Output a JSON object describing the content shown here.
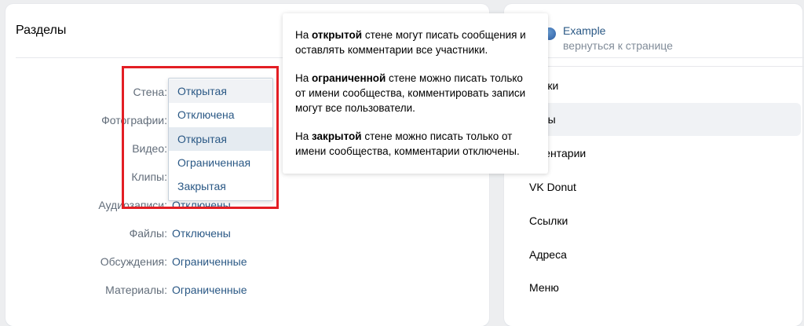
{
  "section_title": "Разделы",
  "rows": [
    {
      "label": "Стена:",
      "value": ""
    },
    {
      "label": "Фотографии:",
      "value": ""
    },
    {
      "label": "Видео:",
      "value": ""
    },
    {
      "label": "Клипы:",
      "value": ""
    },
    {
      "label": "Аудиозаписи:",
      "value": "Отключены"
    },
    {
      "label": "Файлы:",
      "value": "Отключены"
    },
    {
      "label": "Обсуждения:",
      "value": "Ограниченные"
    },
    {
      "label": "Материалы:",
      "value": "Ограниченные"
    }
  ],
  "dropdown": {
    "current": "Открытая",
    "options": [
      "Отключена",
      "Открытая",
      "Ограниченная",
      "Закрытая"
    ]
  },
  "tooltip": {
    "p1_a": "На ",
    "p1_b": "открытой",
    "p1_c": " стене могут писать сообщения и оставлять комментарии все участники.",
    "p2_a": "На ",
    "p2_b": "ограниченной",
    "p2_c": " стене можно писать только от имени сообщества, комментировать записи могут все пользователи.",
    "p3_a": "На ",
    "p3_b": "закрытой",
    "p3_c": " стене можно писать только от имени сообщества, комментарии отключены."
  },
  "side": {
    "community_name": "Example",
    "back_link": "вернуться к странице",
    "items": [
      "ройки",
      "делы",
      "мментарии",
      "VK Donut",
      "Ссылки",
      "Адреса",
      "Меню"
    ],
    "active_index": 1
  },
  "colors": {
    "accent": "#2a5885",
    "highlight": "#e31e24"
  }
}
